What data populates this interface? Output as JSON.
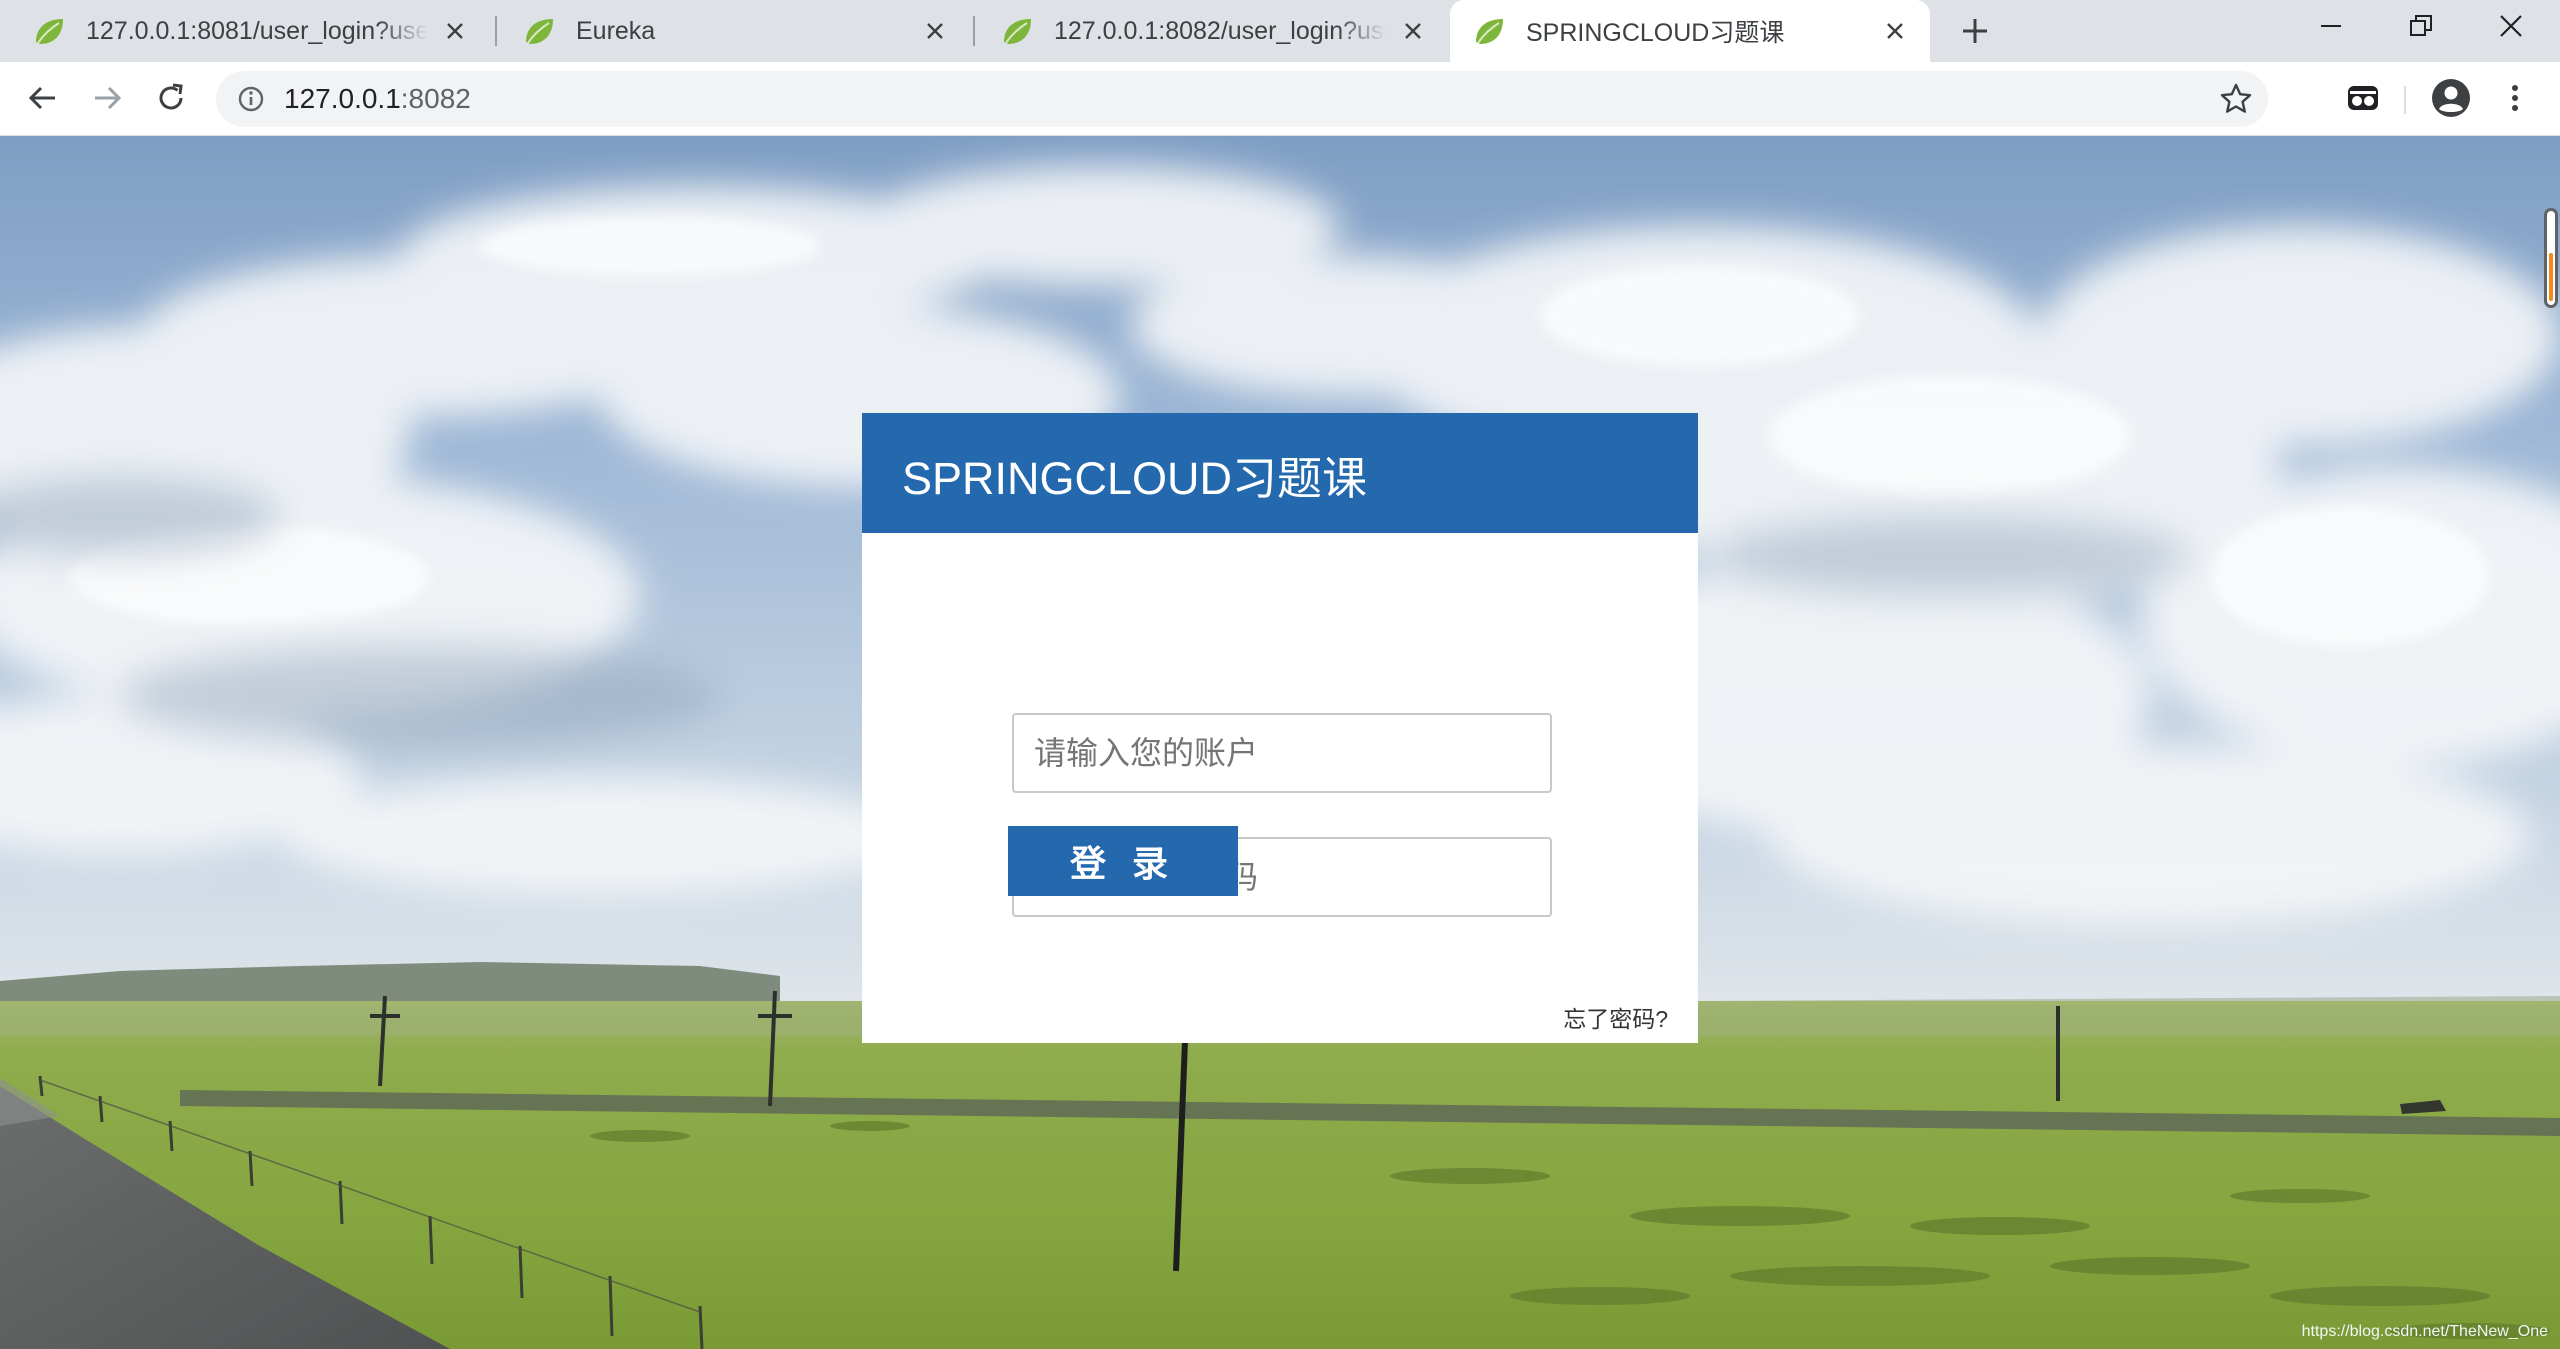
{
  "browser": {
    "tabs": [
      {
        "title": "127.0.0.1:8081/user_login?user",
        "active": false
      },
      {
        "title": "Eureka",
        "active": false
      },
      {
        "title": "127.0.0.1:8082/user_login?user",
        "active": false
      },
      {
        "title": "SPRINGCLOUD习题课",
        "active": true
      }
    ],
    "address": {
      "host": "127.0.0.1",
      "port": ":8082"
    },
    "icons": {
      "favicon": "spring-leaf-icon",
      "back": "arrow-left-icon",
      "forward": "arrow-right-icon",
      "reload": "reload-icon",
      "info": "info-icon",
      "bookmark": "star-icon",
      "extension": "incognito-extension-icon",
      "profile": "account-icon",
      "menu": "kebab-menu-icon"
    }
  },
  "login": {
    "title": "SPRINGCLOUD习题课",
    "account_placeholder": "请输入您的账户",
    "password_placeholder": "请输入您的密码",
    "submit_label": "登 录",
    "forgot_label": "忘了密码?"
  },
  "watermark": "https://blog.csdn.net/TheNew_One",
  "colors": {
    "brand": "#2468ad",
    "card": "#ffffff",
    "tab_strip": "#dee1e6"
  }
}
